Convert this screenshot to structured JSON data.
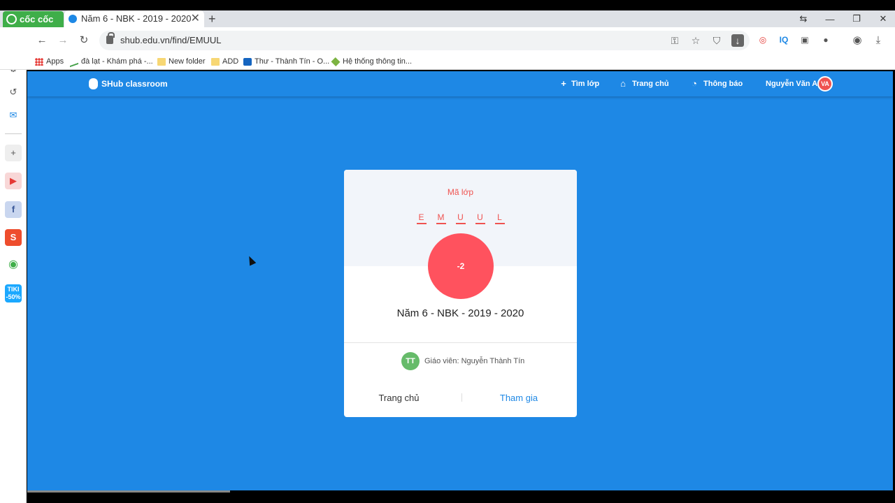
{
  "browser": {
    "brand": "cốc cốc",
    "tab_title": "Năm 6 - NBK - 2019 - 2020",
    "tab_close": "✕",
    "new_tab": "+",
    "url": "shub.edu.vn/find/EMUUL",
    "bookmarks": [
      {
        "label": "Apps",
        "icon": "apps-grid-icon"
      },
      {
        "label": "đà lạt - Khám phá -...",
        "icon": "trend-icon"
      },
      {
        "label": "New folder",
        "icon": "folder-icon"
      },
      {
        "label": "ADD",
        "icon": "folder-icon"
      },
      {
        "label": "Thư - Thành Tín - O...",
        "icon": "outlook-icon"
      },
      {
        "label": "Hệ thống thông tin...",
        "icon": "diamond-icon"
      }
    ],
    "extensions": [
      "◎",
      "IQ",
      "▣",
      "●"
    ],
    "sidebar_tiki": "TIKI\n-50%"
  },
  "app": {
    "name": "SHub classroom",
    "nav": {
      "find_class": "Tìm lớp",
      "home": "Trang chủ",
      "notifications": "Thông báo"
    },
    "user": {
      "name": "Nguyễn Văn A",
      "initials": "VA"
    }
  },
  "card": {
    "code_label": "Mã lớp",
    "code_letters": [
      "E",
      "M",
      "U",
      "U",
      "L"
    ],
    "badge_text": "-2",
    "class_name": "Năm 6 - NBK - 2019 - 2020",
    "teacher_initials": "TT",
    "teacher_text": "Giáo viên: Nguyễn Thành Tín",
    "home_button": "Trang chủ",
    "join_button": "Tham gia"
  },
  "colors": {
    "primary": "#1e88e5",
    "accent_red": "#ef5350",
    "badge": "#ff525e",
    "teacher_avatar": "#66bb6a",
    "brand_green": "#3fae49"
  }
}
